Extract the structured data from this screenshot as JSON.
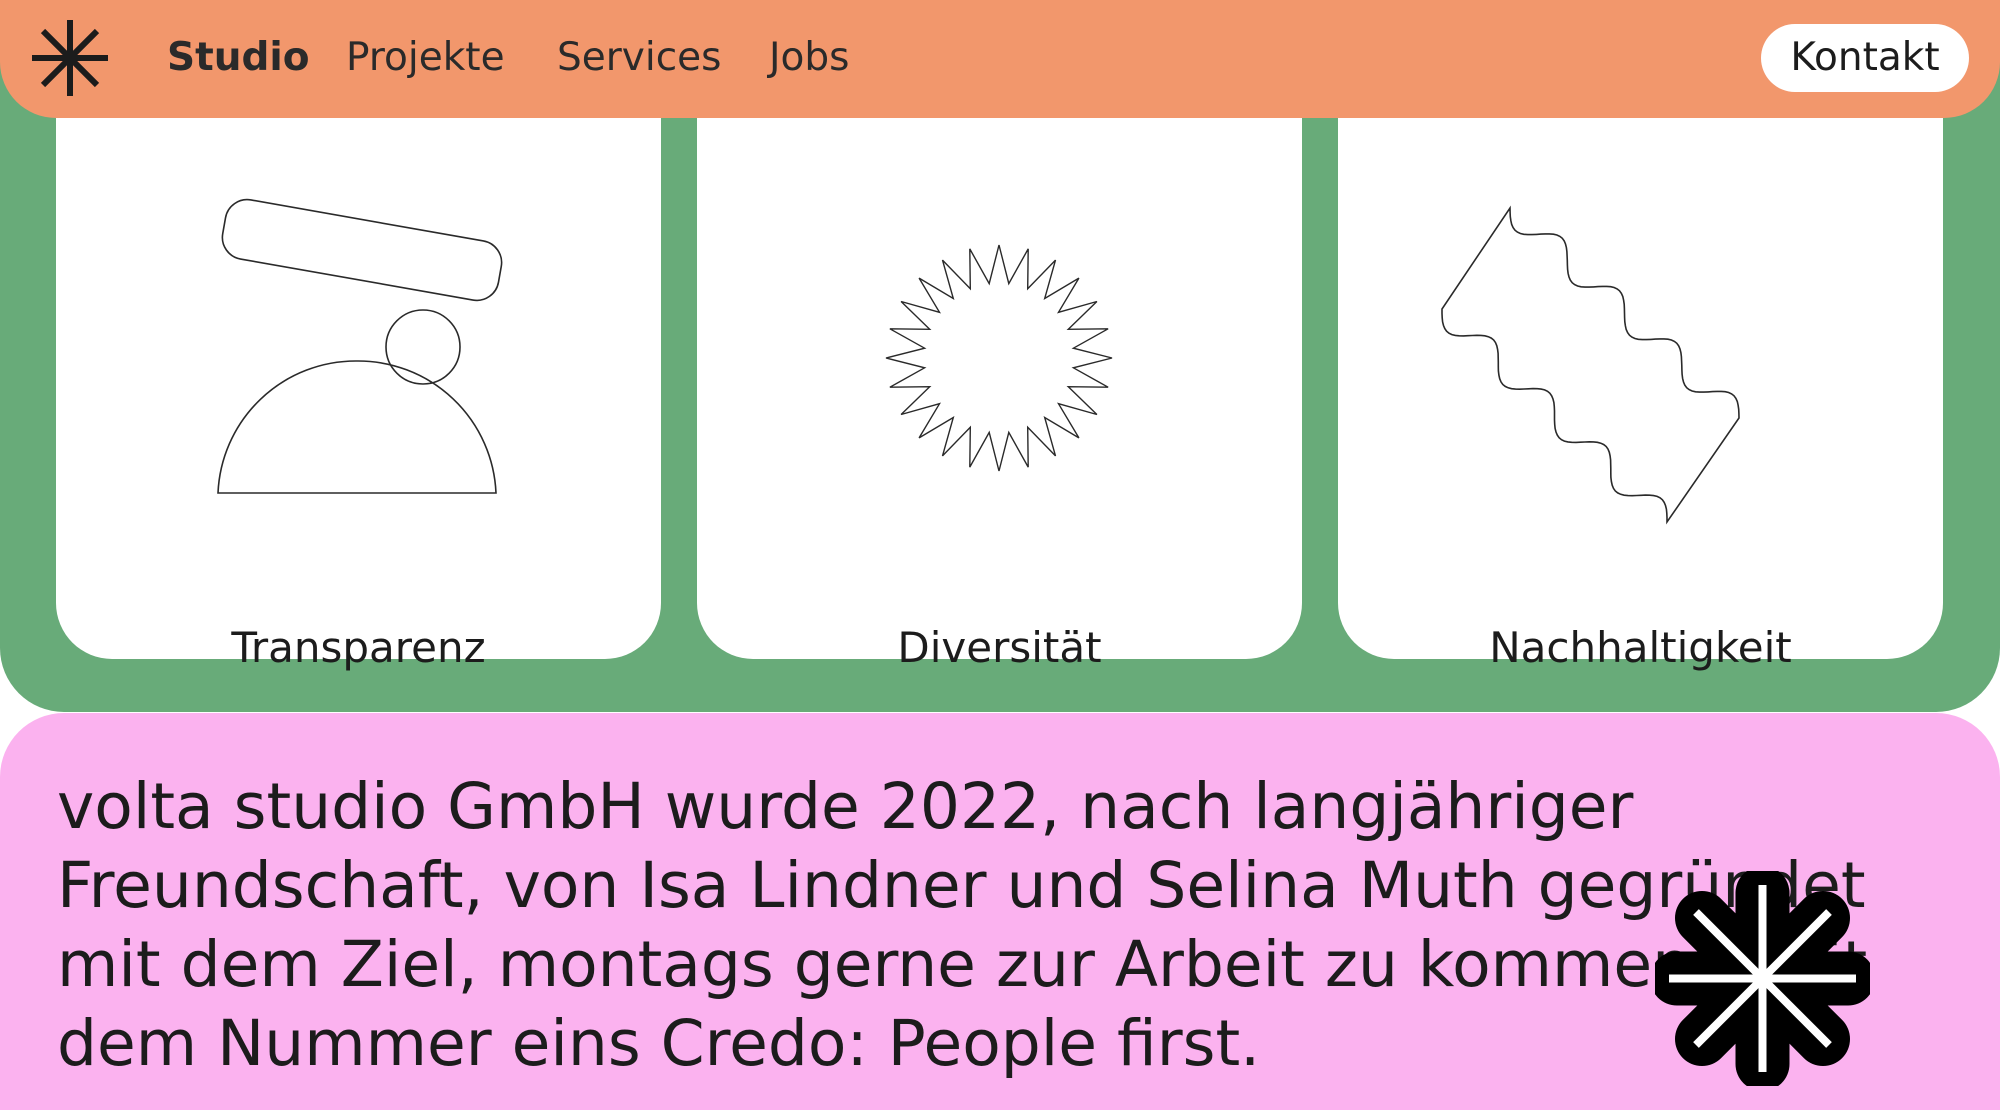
{
  "nav": {
    "logo_icon": "asterisk-logo-icon",
    "links": [
      "Studio",
      "Projekte",
      "Services",
      "Jobs"
    ],
    "active": "Studio",
    "contact_label": "Kontakt"
  },
  "values": [
    {
      "label": "Transparenz",
      "icon": "balanced-shapes-icon"
    },
    {
      "label": "Diversität",
      "icon": "starburst-icon"
    },
    {
      "label": "Nachhaltigkeit",
      "icon": "wavy-ribbon-icon"
    }
  ],
  "intro": {
    "lines": [
      "volta studio GmbH wurde 2022, nach langjähriger",
      "Freundschaft, von Isa Lindner und Selina Muth gegründet",
      "mit dem Ziel, montags gerne zur Arbeit zu kommen – mit",
      "dem Nummer eins Credo: People first."
    ],
    "badge_icon": "asterisk-badge-icon"
  },
  "colors": {
    "nav_bg": "#f2976c",
    "green_bg": "#68ab79",
    "pink_bg": "#fbb2ef",
    "card_bg": "#ffffff",
    "text": "#1c1c1c"
  }
}
